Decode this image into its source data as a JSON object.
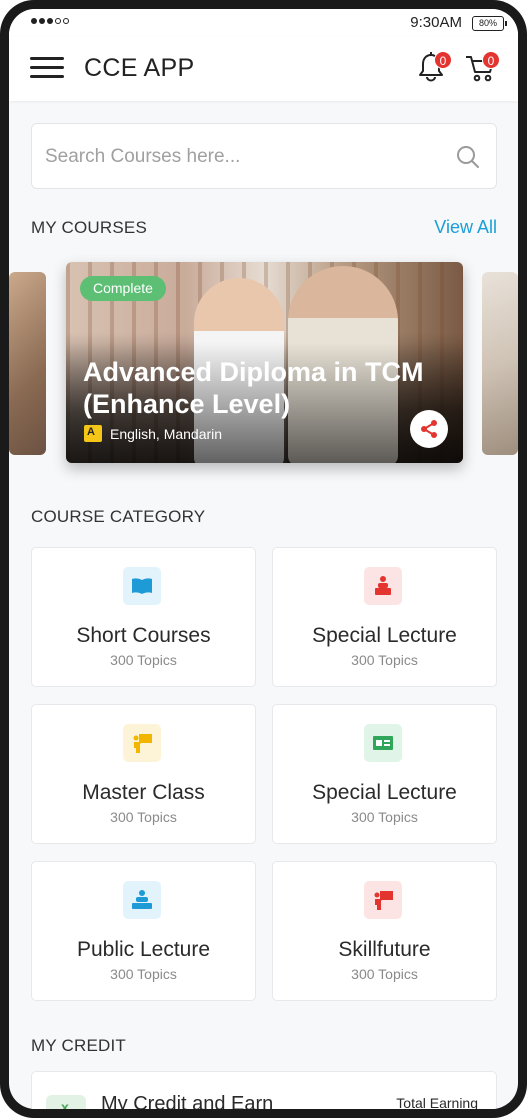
{
  "status_bar": {
    "time": "9:30AM",
    "battery": "80%"
  },
  "header": {
    "title": "CCE APP",
    "notifications_count": "0",
    "cart_count": "0"
  },
  "search": {
    "placeholder": "Search Courses here..."
  },
  "my_courses": {
    "title": "MY COURSES",
    "view_all": "View All",
    "featured": {
      "status": "Complete",
      "title_line1": "Advanced Diploma in TCM",
      "title_line2": "(Enhance Level)",
      "languages": "English, Mandarin"
    }
  },
  "course_category": {
    "title": "COURSE CATEGORY",
    "items": [
      {
        "title": "Short Courses",
        "topics": "300 Topics",
        "icon": "book-icon",
        "color": "#1e9ad6",
        "bg": "#e3f3fb"
      },
      {
        "title": "Special Lecture",
        "topics": "300 Topics",
        "icon": "lecturer-icon",
        "color": "#e3342f",
        "bg": "#fde4e4"
      },
      {
        "title": "Master Class",
        "topics": "300 Topics",
        "icon": "teacher-board-icon",
        "color": "#f2b600",
        "bg": "#fdf4d8"
      },
      {
        "title": "Special Lecture",
        "topics": "300 Topics",
        "icon": "certificate-icon",
        "color": "#2fa65a",
        "bg": "#e0f4e7"
      },
      {
        "title": "Public Lecture",
        "topics": "300 Topics",
        "icon": "audience-icon",
        "color": "#1e9ad6",
        "bg": "#e3f3fb"
      },
      {
        "title": "Skillfuture",
        "topics": "300 Topics",
        "icon": "presenter-icon",
        "color": "#e3342f",
        "bg": "#fde4e4"
      }
    ]
  },
  "my_credit": {
    "title": "MY CREDIT",
    "card_title": "My Credit and Earn",
    "total_label": "Total Earning"
  }
}
